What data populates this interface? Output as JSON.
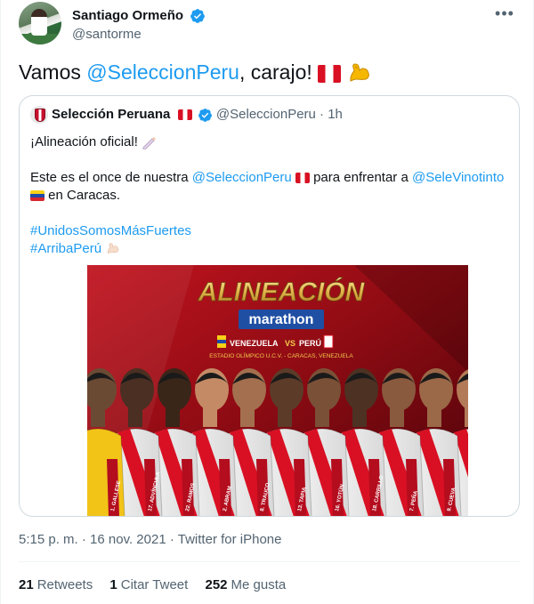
{
  "author": {
    "display_name": "Santiago Ormeño",
    "handle": "@santorme",
    "verified": true
  },
  "more_icon": "more-horizontal-icon",
  "tweet": {
    "text_prefix": "Vamos ",
    "mention": "@SeleccionPeru",
    "text_suffix": ", carajo! ",
    "emoji": [
      "peru-flag",
      "flexed-biceps"
    ]
  },
  "quoted": {
    "display_name": "Selección Peruana",
    "handle": "@SeleccionPeru",
    "separator": "·",
    "time": "1h",
    "line1": "¡Alineación oficial! ",
    "line2_prefix": "Este es el once de nuestra ",
    "line2_mention": "@SeleccionPeru",
    "line2_middle": " para enfrentar a ",
    "line2_mention2": "@SeleVinotinto",
    "line3": " en Caracas.",
    "hashtag1": "#UnidosSomosMásFuertes",
    "hashtag2": "#ArribaPerú",
    "image": {
      "title": "ALINEACIÓN",
      "sponsor": "marathon",
      "team_home": "VENEZUELA",
      "vs": "VS",
      "team_away": "PERÚ",
      "venue": "ESTADIO OLÍMPICO U.C.V. - CARACAS, VENEZUELA",
      "players": [
        "1. GALLESE",
        "17. ADVÍNCULA",
        "22. RAMOS",
        "2. ABRAM",
        "8. TRAUCO",
        "13. TAPIA",
        "16. YOTÚN",
        "18. CARRILLO",
        "7. PEÑA",
        "9. CUEVA",
        "8. LAPADULA"
      ]
    }
  },
  "meta": {
    "time": "5:15 p. m.",
    "dot": "·",
    "date": "16 nov. 2021",
    "client": "Twitter for iPhone"
  },
  "stats": {
    "retweets_count": "21",
    "retweets_label": "Retweets",
    "quotes_count": "1",
    "quotes_label": "Citar Tweet",
    "likes_count": "252",
    "likes_label": "Me gusta"
  },
  "colors": {
    "accent": "#1d9bf0",
    "secondary_text": "#536471",
    "border": "#cfd9de",
    "peru_red": "#d91023"
  }
}
